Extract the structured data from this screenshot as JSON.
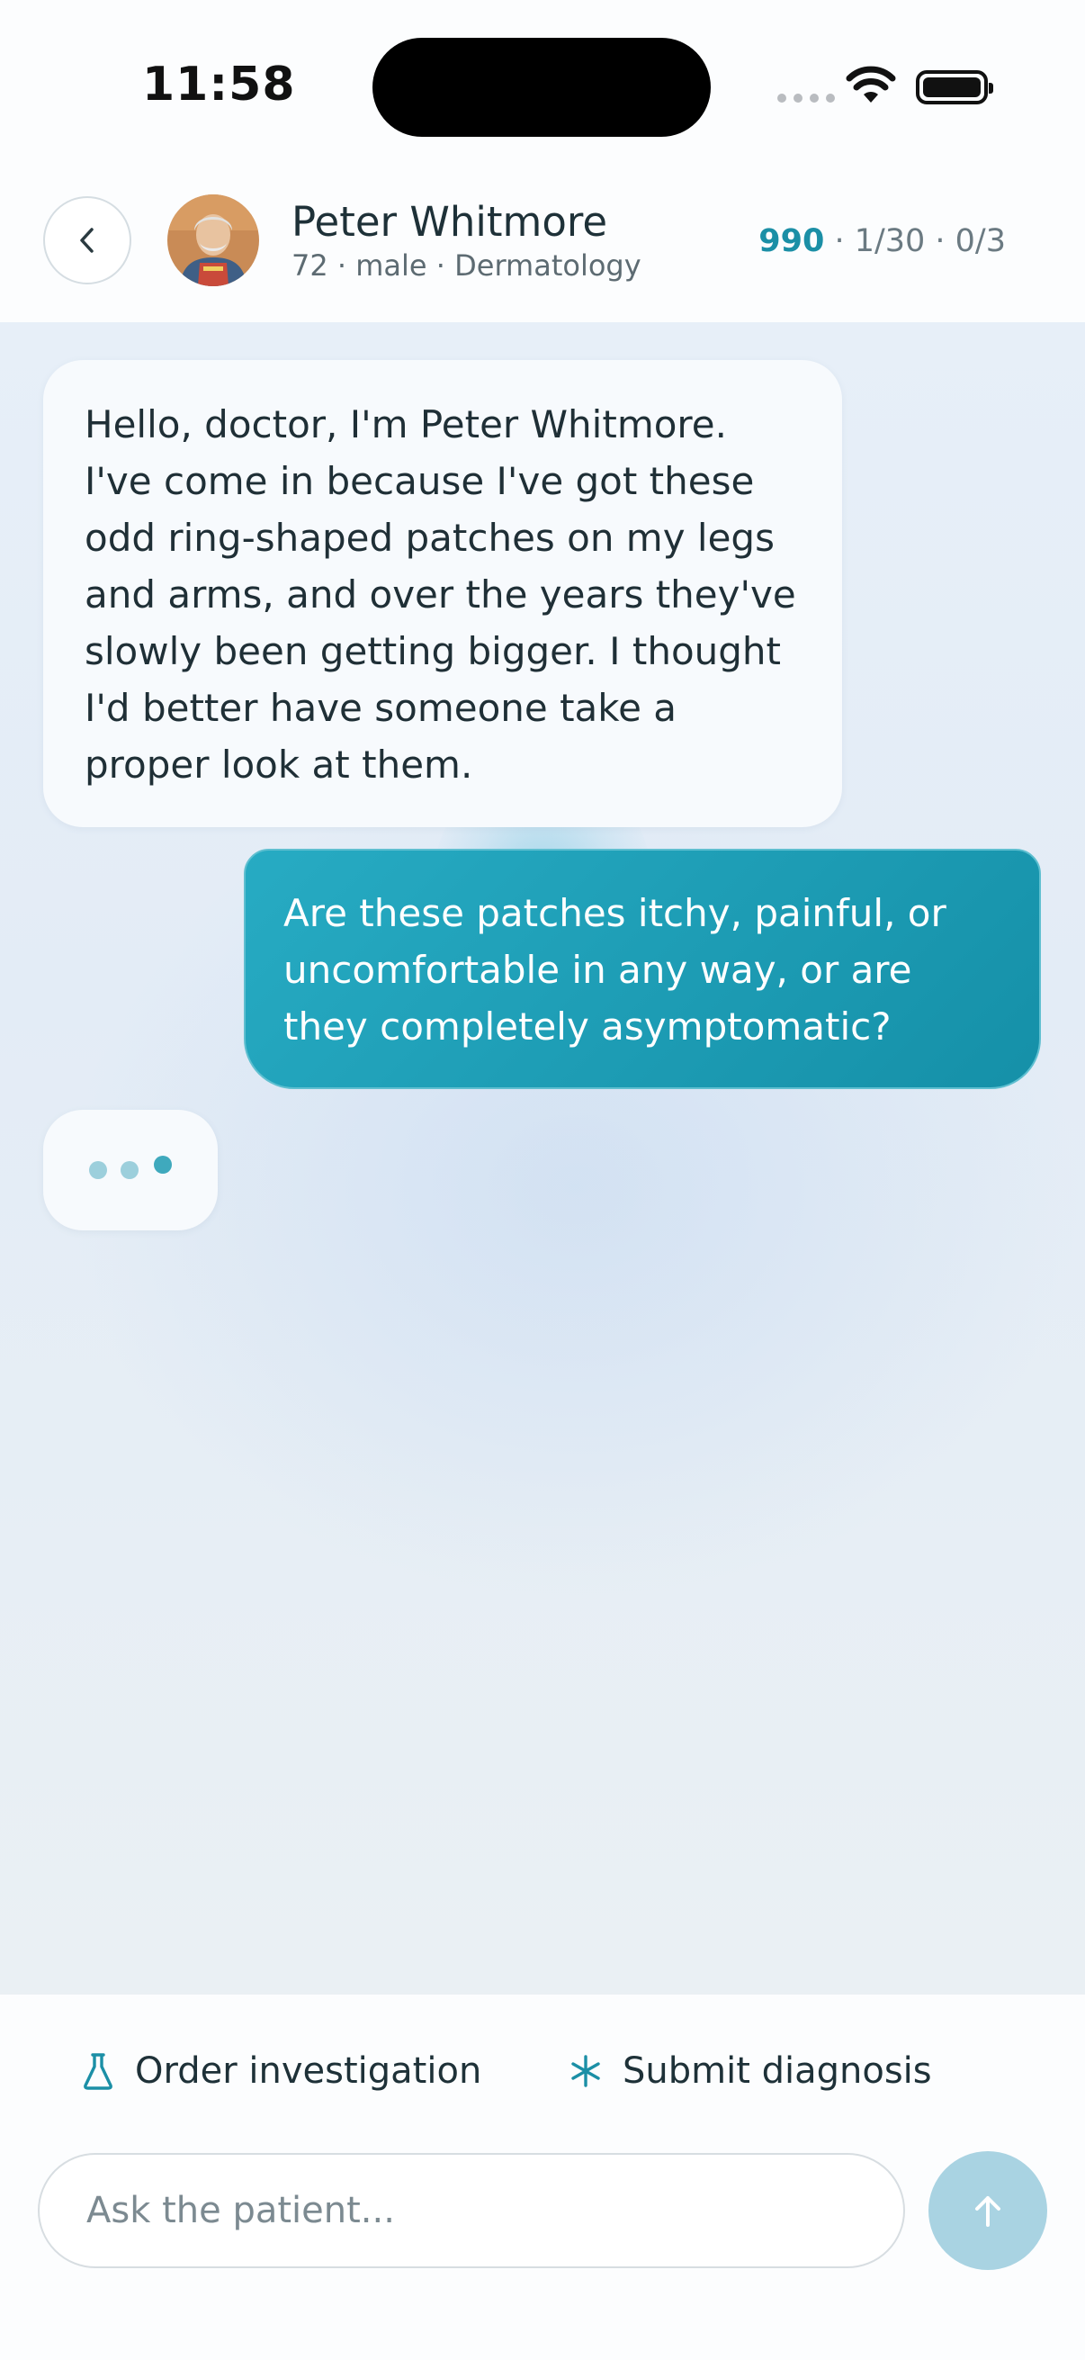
{
  "status_bar": {
    "time": "11:58"
  },
  "header": {
    "patient_name": "Peter Whitmore",
    "patient_subtitle": "72 · male · Dermatology",
    "score": "990",
    "progress": "· 1/30 · 0/3",
    "back_icon": "chevron-left-icon",
    "accent_color": "#1b8fa6"
  },
  "messages": [
    {
      "role": "patient",
      "text": "Hello, doctor, I'm Peter Whitmore. I've come in because I've got these odd ring-shaped patches on my legs and arms, and over the years they've slowly been getting bigger. I thought I'd better have someone take a proper look at them."
    },
    {
      "role": "doctor",
      "text": "Are these patches itchy, painful, or uncomfortable in any way, or are they completely asymptomatic?"
    }
  ],
  "actions": {
    "order_investigation": "Order investigation",
    "submit_diagnosis": "Submit diagnosis"
  },
  "composer": {
    "placeholder": "Ask the patient...",
    "send_icon": "arrow-up-icon"
  }
}
